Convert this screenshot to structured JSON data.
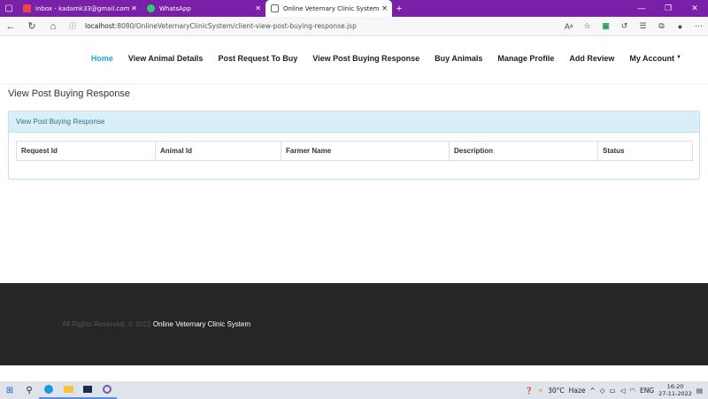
{
  "browser": {
    "tabs": [
      {
        "title": "Inbox - kadamk33@gmail.com -",
        "icon": "gmail-icon"
      },
      {
        "title": "WhatsApp",
        "icon": "whatsapp-icon"
      },
      {
        "title": "Online Veternary Clinic System",
        "icon": "page-icon",
        "active": true
      }
    ],
    "url_host": "localhost",
    "url_path": ":8080/OnlineVeternaryClinicSystem/client-view-post-buying-response.jsp"
  },
  "nav": {
    "items": [
      "Home",
      "View Animal Details",
      "Post Request To Buy",
      "View Post Buying Response",
      "Buy Animals",
      "Manage Profile",
      "Add Review",
      "My Account"
    ],
    "active": "Home"
  },
  "page": {
    "title": "View Post Buying Response",
    "panel_title": "View Post Buying Response",
    "table_headers": [
      "Request Id",
      "Animal Id",
      "Farmer Name",
      "Description",
      "Status"
    ]
  },
  "footer": {
    "copyright": "All Rights Reserved. © 2022",
    "site_name": "Online Veternary Clinic System"
  },
  "taskbar": {
    "weather": "30°C",
    "weather_desc": "Haze",
    "lang": "ENG",
    "time": "16:20",
    "date": "27-11-2022"
  },
  "colors": {
    "accent": "#1aa8d5",
    "tabbar": "#7a1fa8",
    "footer": "#262626"
  }
}
